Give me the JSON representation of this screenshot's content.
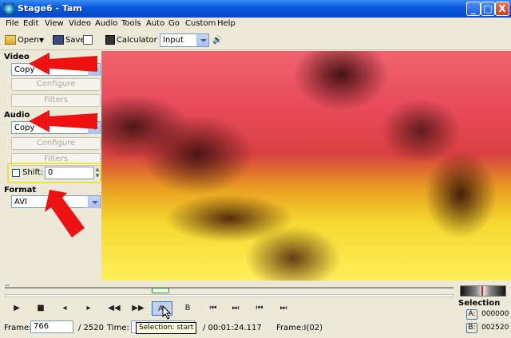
{
  "window": {
    "title": "Stage6 - Tam",
    "controls": {
      "minimize": "_",
      "maximize": "□",
      "close": "X"
    }
  },
  "menu": [
    "File",
    "Edit",
    "View",
    "Video",
    "Audio",
    "Tools",
    "Auto",
    "Go",
    "Custom",
    "Help"
  ],
  "toolbar": {
    "open_label": "Open",
    "save_label": "Save",
    "calculator_label": "Calculator",
    "input_select_value": "Input"
  },
  "panel": {
    "video_label": "Video",
    "video_mode": "Copy",
    "video_configure": "Configure",
    "video_filters": "Filters",
    "audio_label": "Audio",
    "audio_mode": "Copy",
    "audio_configure": "Configure",
    "audio_filters": "Filters",
    "shift_label": "Shift:",
    "shift_value": "0",
    "format_label": "Format",
    "format_value": "AVI"
  },
  "controls": {
    "play": "▶",
    "stop": "■",
    "a_marker": "A:",
    "b_marker": "B"
  },
  "status": {
    "frame_label": "Frame:",
    "frame_value": "766",
    "frame_total": "/ 2520",
    "time_label": "Time:",
    "time_total": "/ 00:01:24.117",
    "frame_type": "Frame:I(02)",
    "tooltip": "Selection: start"
  },
  "selection": {
    "label": "Selection",
    "a_label": "A:",
    "a_value": "000000",
    "b_label": "B:",
    "b_value": "002520"
  },
  "colors": {
    "titlebar": "#0a5be0",
    "annotation_arrow": "#ee1111",
    "annotation_highlight": "#f0e040"
  }
}
